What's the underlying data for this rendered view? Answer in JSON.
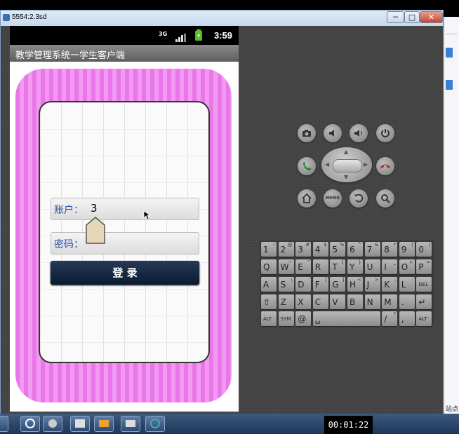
{
  "window": {
    "title": "5554:2.3sd",
    "minimize": "─",
    "maximize": "□",
    "close": "✕"
  },
  "status_bar": {
    "network": "3G",
    "time": "3:59"
  },
  "app": {
    "title": "教学管理系统一学生客户端"
  },
  "form": {
    "account_label": "账户：",
    "account_value": "3",
    "password_label": "密码：",
    "password_value": "",
    "login_button": "登      录"
  },
  "hardware_keys": [
    "camera",
    "volume-down",
    "volume-up",
    "power",
    "call",
    "end-call",
    "home",
    "MENU",
    "back",
    "search"
  ],
  "keyboard": {
    "rows": [
      [
        [
          "1",
          "!"
        ],
        [
          "2",
          "@"
        ],
        [
          "3",
          "#"
        ],
        [
          "4",
          "$"
        ],
        [
          "5",
          "%"
        ],
        [
          "6",
          "^"
        ],
        [
          "7",
          "&"
        ],
        [
          "8",
          "*"
        ],
        [
          "9",
          "("
        ],
        [
          "0",
          ")"
        ]
      ],
      [
        [
          "Q",
          ""
        ],
        [
          "W",
          "~"
        ],
        [
          "E",
          "\""
        ],
        [
          "R",
          "`"
        ],
        [
          "T",
          "{"
        ],
        [
          "Y",
          "}"
        ],
        [
          "U",
          "-"
        ],
        [
          "I",
          "_"
        ],
        [
          "O",
          "+"
        ],
        [
          "P",
          "="
        ]
      ],
      [
        [
          "A",
          ""
        ],
        [
          "S",
          "\\"
        ],
        [
          "D",
          "'"
        ],
        [
          "F",
          "["
        ],
        [
          "G",
          "]"
        ],
        [
          "H",
          "<"
        ],
        [
          "J",
          ">"
        ],
        [
          "K",
          ";"
        ],
        [
          "L",
          ":"
        ],
        [
          "DEL",
          ""
        ]
      ],
      [
        [
          "⇧",
          ""
        ],
        [
          "Z",
          ""
        ],
        [
          "X",
          ""
        ],
        [
          "C",
          ""
        ],
        [
          "V",
          ""
        ],
        [
          "B",
          ""
        ],
        [
          "N",
          ""
        ],
        [
          "M",
          ""
        ],
        [
          ".",
          ""
        ],
        [
          "↵",
          ""
        ]
      ],
      [
        [
          "ALT",
          ""
        ],
        [
          "SYM",
          ""
        ],
        [
          "@",
          ""
        ],
        [
          "␣",
          ""
        ],
        [
          "/",
          "?"
        ],
        [
          ",",
          ""
        ],
        [
          "ALT",
          ""
        ]
      ]
    ]
  },
  "side_window": {
    "text": "站点"
  },
  "recording_timer": "00:01:22"
}
